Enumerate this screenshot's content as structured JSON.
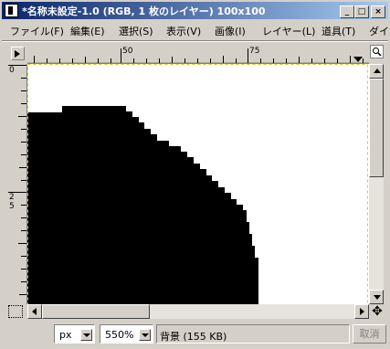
{
  "window": {
    "title": "*名称未設定-1.0 (RGB, 1 枚のレイヤー) 100x100",
    "minimize_symbol": "_",
    "maximize_symbol": "□",
    "close_symbol": "×"
  },
  "menu": {
    "items": [
      "ファイル(F)",
      "編集(E)",
      "選択(S)",
      "表示(V)",
      "画像(I)",
      "レイヤー(L)",
      "道具(T)",
      "ダイ"
    ]
  },
  "ruler": {
    "h_labels": [
      "50",
      "75"
    ],
    "v_labels": [
      "0",
      "2",
      "5"
    ]
  },
  "statusbar": {
    "unit": "px",
    "zoom": "550%",
    "info": "背景 (155 KB)",
    "cancel_label": "取消"
  },
  "colors": {
    "title_gradient_start": "#0a246a",
    "title_gradient_end": "#a6caf0",
    "image_fill": "#000000",
    "image_bg": "#ffffff",
    "selection_border": "#e6c800"
  },
  "icons": {
    "app": "gimp-document-icon",
    "quick_mask": "quick-mask-icon",
    "navigate": "move-cross-icon"
  }
}
